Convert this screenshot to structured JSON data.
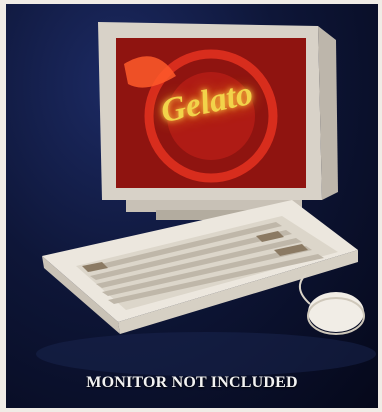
{
  "photo": {
    "subject_icon": "computer-keyboard-mouse-photo",
    "screen_word": "Gelato",
    "caption": "MONITOR NOT INCLUDED"
  },
  "colors": {
    "backdrop": "#0e1638",
    "neon_red": "#d0221a",
    "neon_yellow": "#f2d34a",
    "casing": "#e9e4dc"
  }
}
